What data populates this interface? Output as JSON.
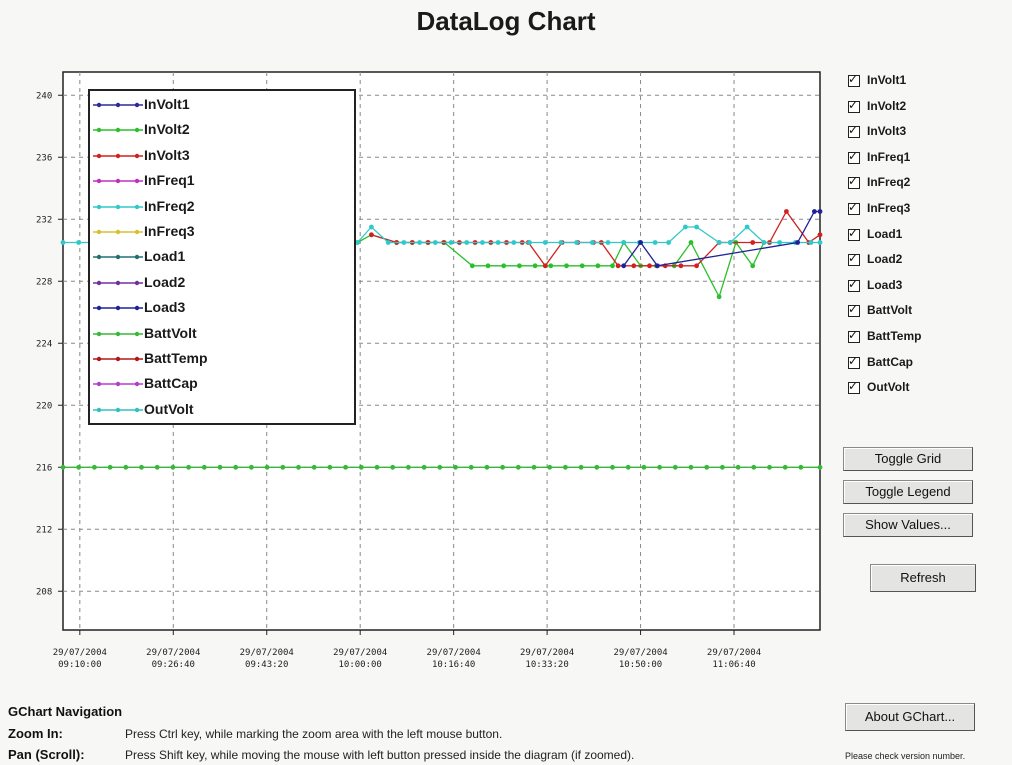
{
  "window": {
    "title": "DataLog Chart"
  },
  "chart_data": {
    "type": "line",
    "title": "DataLog Chart",
    "x": [
      "29/07/2004 09:10:00",
      "29/07/2004 09:26:40",
      "29/07/2004 09:43:20",
      "29/07/2004 10:00:00",
      "29/07/2004 10:16:40",
      "29/07/2004 10:33:20",
      "29/07/2004 10:50:00",
      "29/07/2004 11:06:40"
    ],
    "x_tick_labels": [
      {
        "date": "29/07/2004",
        "time": "09:10:00"
      },
      {
        "date": "29/07/2004",
        "time": "09:26:40"
      },
      {
        "date": "29/07/2004",
        "time": "09:43:20"
      },
      {
        "date": "29/07/2004",
        "time": "10:00:00"
      },
      {
        "date": "29/07/2004",
        "time": "10:16:40"
      },
      {
        "date": "29/07/2004",
        "time": "10:33:20"
      },
      {
        "date": "29/07/2004",
        "time": "10:50:00"
      },
      {
        "date": "29/07/2004",
        "time": "11:06:40"
      }
    ],
    "y_ticks": [
      208,
      212,
      216,
      220,
      224,
      228,
      232,
      236,
      240
    ],
    "ylim": [
      205.5,
      241.5
    ],
    "x_range_minutes": [
      -3,
      132
    ],
    "grid": true,
    "legend": "top-left",
    "series": [
      {
        "name": "InVolt1",
        "color": "#2a2a9a",
        "points": []
      },
      {
        "name": "InVolt2",
        "color": "#2bbf2b",
        "points": [
          [
            49.5,
            230.5
          ],
          [
            52,
            231
          ],
          [
            56.5,
            230.5
          ],
          [
            65,
            230.5
          ],
          [
            70,
            229
          ],
          [
            95,
            229
          ],
          [
            97,
            230.5
          ],
          [
            100,
            229
          ],
          [
            106,
            229
          ],
          [
            109,
            230.5
          ],
          [
            114,
            227
          ],
          [
            117,
            230.5
          ],
          [
            120,
            229
          ],
          [
            122,
            230.5
          ]
        ]
      },
      {
        "name": "InVolt3",
        "color": "#d02020",
        "points": [
          [
            52,
            231
          ],
          [
            56.5,
            230.5
          ],
          [
            80,
            230.5
          ],
          [
            83,
            229
          ],
          [
            86,
            230.5
          ],
          [
            93,
            230.5
          ],
          [
            96,
            229
          ],
          [
            110,
            229
          ],
          [
            114,
            230.5
          ],
          [
            116,
            230.5
          ],
          [
            120,
            230.5
          ],
          [
            123,
            230.5
          ],
          [
            126,
            232.5
          ],
          [
            130,
            230.5
          ],
          [
            132,
            231
          ]
        ]
      },
      {
        "name": "InFreq1",
        "color": "#c030c0",
        "points": []
      },
      {
        "name": "InFreq2",
        "color": "#30c8c8",
        "points": [
          [
            -3,
            230.5
          ],
          [
            49.5,
            230.5
          ],
          [
            52,
            231.5
          ],
          [
            55,
            230.5
          ],
          [
            105,
            230.5
          ],
          [
            108,
            231.5
          ],
          [
            110,
            231.5
          ],
          [
            114,
            230.5
          ],
          [
            116,
            230.5
          ],
          [
            119,
            231.5
          ],
          [
            122,
            230.5
          ],
          [
            132,
            230.5
          ]
        ]
      },
      {
        "name": "InFreq3",
        "color": "#d8c030",
        "points": []
      },
      {
        "name": "Load1",
        "color": "#207070",
        "points": []
      },
      {
        "name": "Load2",
        "color": "#7030a0",
        "points": []
      },
      {
        "name": "Load3",
        "color": "#202098",
        "points": [
          [
            97,
            229
          ],
          [
            100,
            230.5
          ],
          [
            103,
            229
          ],
          [
            128,
            230.5
          ],
          [
            131,
            232.5
          ],
          [
            132,
            232.5
          ]
        ]
      },
      {
        "name": "BattVolt",
        "color": "#38b838",
        "points": [
          [
            -3,
            216
          ],
          [
            132,
            216
          ]
        ]
      },
      {
        "name": "BattTemp",
        "color": "#b01818",
        "points": []
      },
      {
        "name": "BattCap",
        "color": "#b040c8",
        "points": []
      },
      {
        "name": "OutVolt",
        "color": "#30c0c0",
        "points": []
      }
    ]
  },
  "legend": {
    "items": [
      {
        "label": "InVolt1",
        "color": "#2a2a9a"
      },
      {
        "label": "InVolt2",
        "color": "#2bbf2b"
      },
      {
        "label": "InVolt3",
        "color": "#d02020"
      },
      {
        "label": "InFreq1",
        "color": "#c030c0"
      },
      {
        "label": "InFreq2",
        "color": "#30c8c8"
      },
      {
        "label": "InFreq3",
        "color": "#d8c030"
      },
      {
        "label": "Load1",
        "color": "#207070"
      },
      {
        "label": "Load2",
        "color": "#7030a0"
      },
      {
        "label": "Load3",
        "color": "#202098"
      },
      {
        "label": "BattVolt",
        "color": "#38b838"
      },
      {
        "label": "BattTemp",
        "color": "#b01818"
      },
      {
        "label": "BattCap",
        "color": "#b040c8"
      },
      {
        "label": "OutVolt",
        "color": "#30c0c0"
      }
    ]
  },
  "series_toggles": [
    {
      "label": "InVolt1",
      "checked": true
    },
    {
      "label": "InVolt2",
      "checked": true
    },
    {
      "label": "InVolt3",
      "checked": true
    },
    {
      "label": "InFreq1",
      "checked": true
    },
    {
      "label": "InFreq2",
      "checked": true
    },
    {
      "label": "InFreq3",
      "checked": true
    },
    {
      "label": "Load1",
      "checked": true
    },
    {
      "label": "Load2",
      "checked": true
    },
    {
      "label": "Load3",
      "checked": true
    },
    {
      "label": "BattVolt",
      "checked": true
    },
    {
      "label": "BattTemp",
      "checked": true
    },
    {
      "label": "BattCap",
      "checked": true
    },
    {
      "label": "OutVolt",
      "checked": true
    }
  ],
  "buttons": {
    "toggle_grid": "Toggle Grid",
    "toggle_legend": "Toggle Legend",
    "show_values": "Show Values...",
    "refresh": "Refresh",
    "about": "About GChart..."
  },
  "navigation": {
    "title": "GChart Navigation",
    "zoom_key": "Zoom In:",
    "zoom_desc": "Press Ctrl key, while marking the zoom area with the left mouse button.",
    "pan_key": "Pan (Scroll):",
    "pan_desc": "Press Shift key, while moving the mouse with left button pressed inside the diagram (if zoomed)."
  },
  "version_note": "Please check version number.",
  "colors": {
    "plot_bg": "#ffffff",
    "grid": "#888888",
    "frame": "#222222",
    "page_bg": "#f7f7f5"
  },
  "icons": {
    "checkbox": "check-mark-icon",
    "legend_marker": "line-with-dot-icon"
  }
}
